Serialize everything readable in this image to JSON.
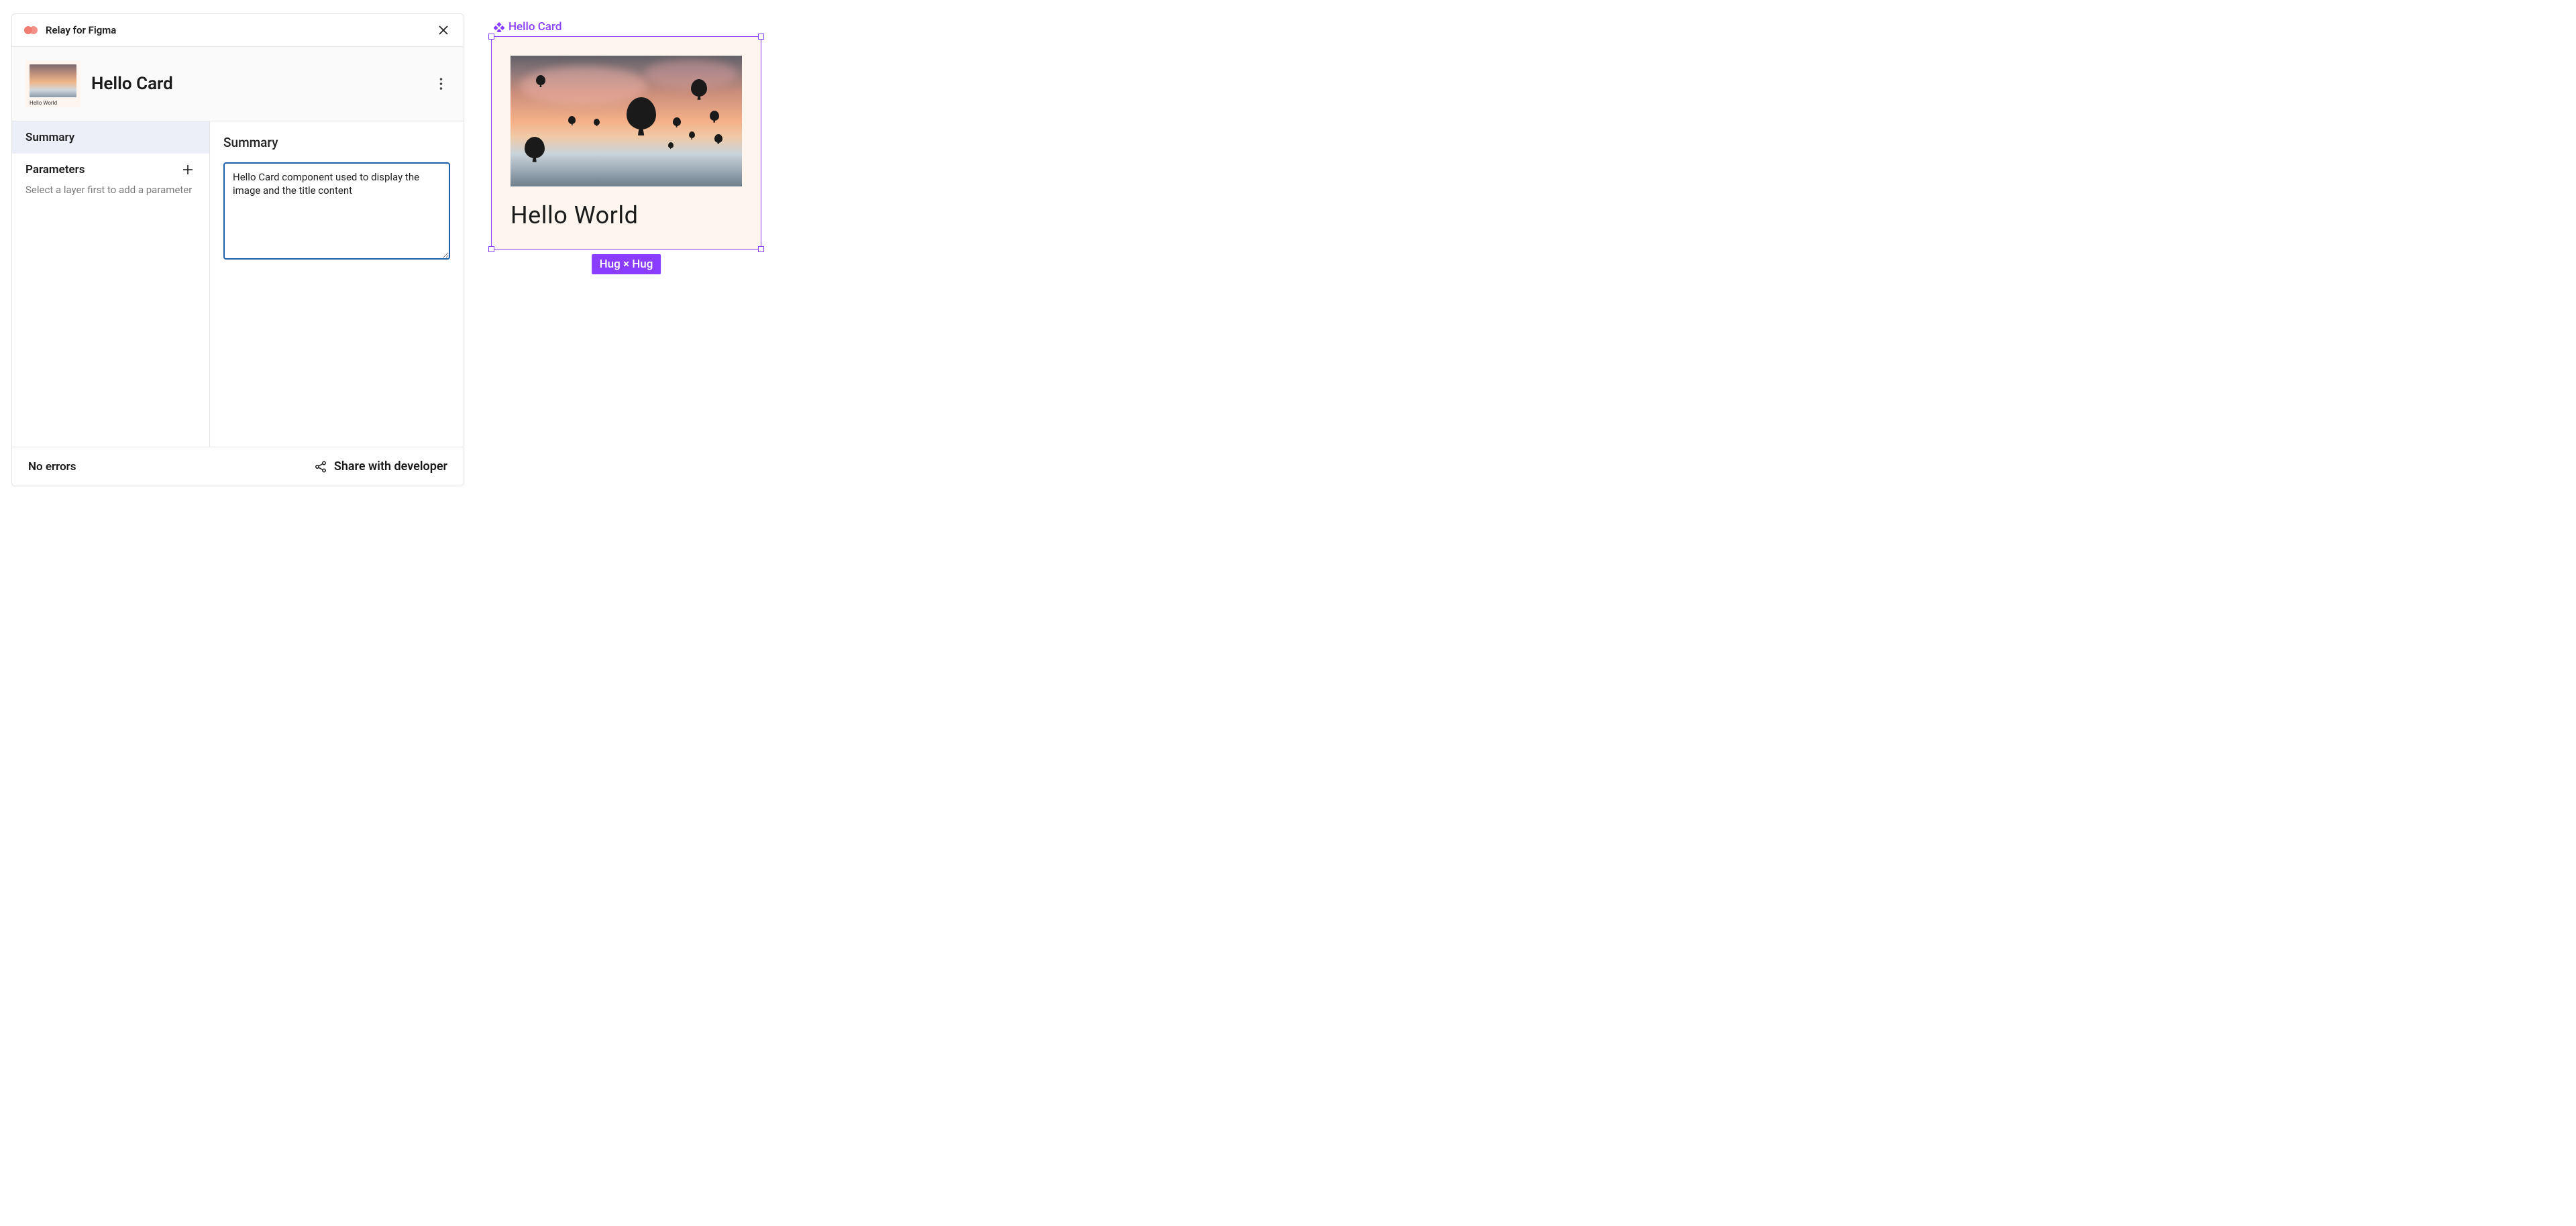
{
  "plugin": {
    "title": "Relay for Figma",
    "component_name": "Hello Card",
    "thumb_caption": "Hello World",
    "sidebar": {
      "summary_tab": "Summary",
      "parameters_label": "Parameters",
      "parameters_hint": "Select a layer first to add a parameter"
    },
    "content": {
      "heading": "Summary",
      "summary_value": "Hello Card component used to display the image and the title content"
    },
    "footer": {
      "errors": "No errors",
      "share": "Share with developer"
    }
  },
  "canvas": {
    "frame_name": "Hello Card",
    "card_title": "Hello World",
    "size_badge": "Hug × Hug"
  },
  "colors": {
    "figma_purple": "#8b3dff",
    "card_bg": "#fdf5ee",
    "textarea_border": "#1f5fa8"
  }
}
